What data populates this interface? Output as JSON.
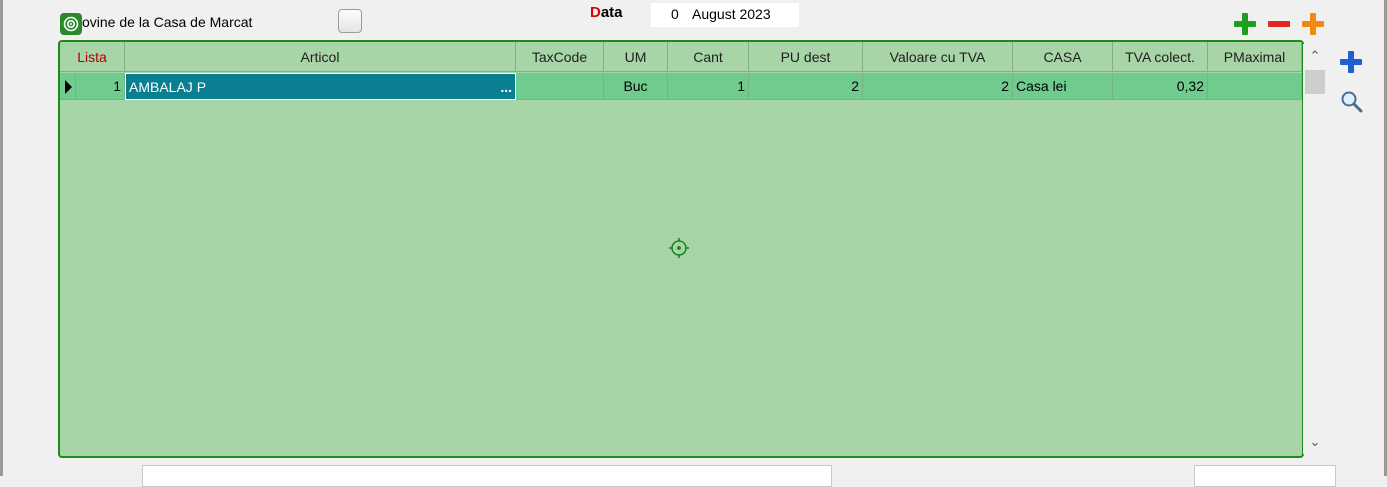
{
  "header": {
    "checkbox_label": "Provine de la Casa de Marcat",
    "date_label_first": "D",
    "date_label_rest": "ata",
    "date_day": "0",
    "date_rest": "August 2023"
  },
  "toolbar": {
    "add_icon": "green-plus-icon",
    "remove_icon": "red-minus-icon",
    "insert_icon": "orange-plus-icon",
    "side_add_icon": "blue-plus-icon",
    "side_search_icon": "magnifier-icon"
  },
  "grid": {
    "columns": [
      "Lista",
      "Articol",
      "TaxCode",
      "UM",
      "Cant",
      "PU dest",
      "Valoare cu TVA",
      "CASA",
      "TVA colect.",
      "PMaximal"
    ],
    "rows": [
      {
        "lista": "1",
        "articol": "AMBALAJ P",
        "articol_button": "...",
        "taxcode": "",
        "um": "Buc",
        "cant": "1",
        "pu_dest": "2",
        "valoare": "2",
        "casa": "Casa lei",
        "tva_colect": "0,32",
        "pmaximal": ""
      }
    ]
  },
  "colors": {
    "grid_background": "#a8d5a8",
    "row_background": "#6fcc8e",
    "selected_cell": "#0a7f92",
    "border_focus": "#1c8a1c"
  }
}
